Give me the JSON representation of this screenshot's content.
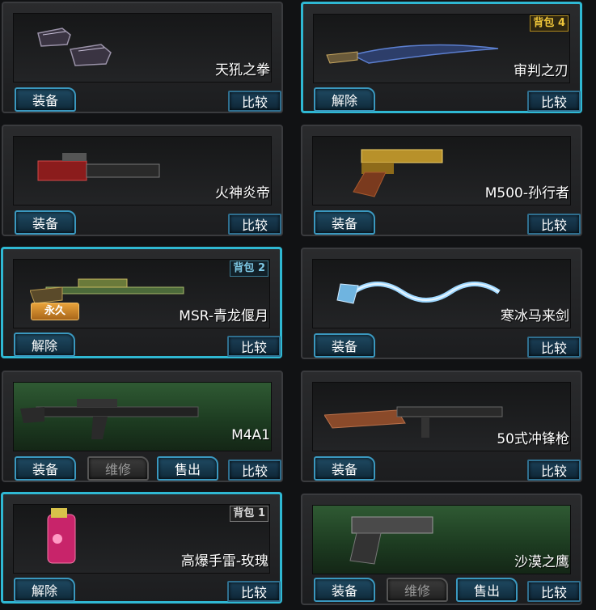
{
  "cards": [
    {
      "name": "天犼之拳",
      "bag": "",
      "buttons": [
        "装备"
      ],
      "compare": "比较"
    },
    {
      "name": "审判之刃",
      "bag": "背包 4",
      "buttons": [
        "解除"
      ],
      "compare": "比较"
    },
    {
      "name": "火神炎帝",
      "bag": "",
      "buttons": [
        "装备"
      ],
      "compare": "比较"
    },
    {
      "name": "M500-孙行者",
      "bag": "",
      "buttons": [
        "装备"
      ],
      "compare": "比较"
    },
    {
      "name": "MSR-青龙偃月",
      "bag": "背包 2",
      "tag": "永久",
      "buttons": [
        "解除"
      ],
      "compare": "比较"
    },
    {
      "name": "寒冰马来剑",
      "bag": "",
      "buttons": [
        "装备"
      ],
      "compare": "比较"
    },
    {
      "name": "M4A1",
      "bag": "",
      "buttons": [
        "装备",
        "维修",
        "售出"
      ],
      "compare": "比较"
    },
    {
      "name": "50式冲锋枪",
      "bag": "",
      "buttons": [
        "装备"
      ],
      "compare": "比较"
    },
    {
      "name": "高爆手雷-玫瑰",
      "bag": "背包 1",
      "buttons": [
        "解除"
      ],
      "compare": "比较"
    },
    {
      "name": "沙漠之鹰",
      "bag": "",
      "buttons": [
        "装备",
        "维修",
        "售出"
      ],
      "compare": "比较"
    }
  ]
}
